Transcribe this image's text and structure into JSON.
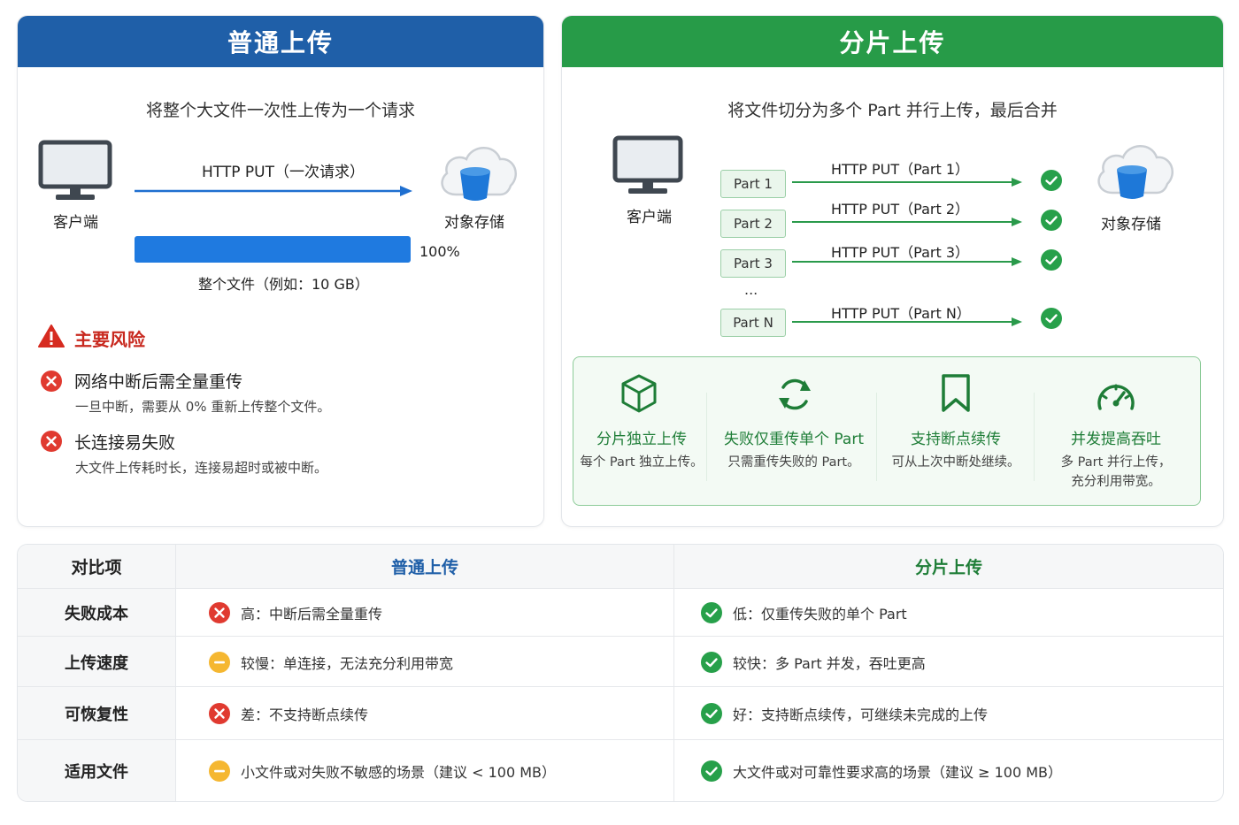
{
  "normal": {
    "title": "普通上传",
    "subtitle": "将整个大文件一次性上传为一个请求",
    "client_label": "客户端",
    "storage_label": "对象存储",
    "request_label": "HTTP PUT（一次请求）",
    "progress_percent": "100%",
    "progress_value": 1.0,
    "file_label": "整个文件（例如：10 GB）",
    "risks_title": "主要风险",
    "risks": [
      {
        "name": "网络中断后需全量重传",
        "desc": "一旦中断，需要从 0% 重新上传整个文件。"
      },
      {
        "name": "长连接易失败",
        "desc": "大文件上传耗时长，连接易超时或被中断。"
      }
    ]
  },
  "multipart": {
    "title": "分片上传",
    "subtitle": "将文件切分为多个 Part 并行上传，最后合并",
    "client_label": "客户端",
    "storage_label": "对象存储",
    "parts": [
      {
        "name": "Part 1",
        "request": "HTTP PUT（Part 1）"
      },
      {
        "name": "Part 2",
        "request": "HTTP PUT（Part 2）"
      },
      {
        "name": "Part 3",
        "request": "HTTP PUT（Part 3）"
      },
      {
        "name": "Part N",
        "request": "HTTP PUT（Part N）"
      }
    ],
    "ellipsis": "...",
    "features": [
      {
        "icon": "cube-icon",
        "title": "分片独立上传",
        "desc": "每个 Part 独立上传。"
      },
      {
        "icon": "refresh-icon",
        "title": "失败仅重传单个 Part",
        "desc": "只需重传失败的 Part。"
      },
      {
        "icon": "bookmark-icon",
        "title": "支持断点续传",
        "desc": "可从上次中断处继续。"
      },
      {
        "icon": "speedometer-icon",
        "title": "并发提高吞吐",
        "desc": "多 Part 并行上传，\n充分利用带宽。"
      }
    ]
  },
  "table": {
    "headers": [
      "对比项",
      "普通上传",
      "分片上传"
    ],
    "rows": [
      {
        "label": "失败成本",
        "normal": {
          "status": "bad",
          "text": "高：中断后需全量重传"
        },
        "multipart": {
          "status": "good",
          "text": "低：仅重传失败的单个 Part"
        }
      },
      {
        "label": "上传速度",
        "normal": {
          "status": "warn",
          "text": "较慢：单连接，无法充分利用带宽"
        },
        "multipart": {
          "status": "good",
          "text": "较快：多 Part 并发，吞吐更高"
        }
      },
      {
        "label": "可恢复性",
        "normal": {
          "status": "bad",
          "text": "差：不支持断点续传"
        },
        "multipart": {
          "status": "good",
          "text": "好：支持断点续传，可继续未完成的上传"
        }
      },
      {
        "label": "适用文件",
        "normal": {
          "status": "warn",
          "text": "小文件或对失败不敏感的场景（建议 < 100 MB）"
        },
        "multipart": {
          "status": "good",
          "text": "大文件或对可靠性要求高的场景（建议 ≥ 100 MB）"
        }
      }
    ]
  },
  "colors": {
    "blue": "#1f5fa8",
    "green": "#279b48",
    "red": "#e03a30",
    "yellow": "#f5b731"
  }
}
